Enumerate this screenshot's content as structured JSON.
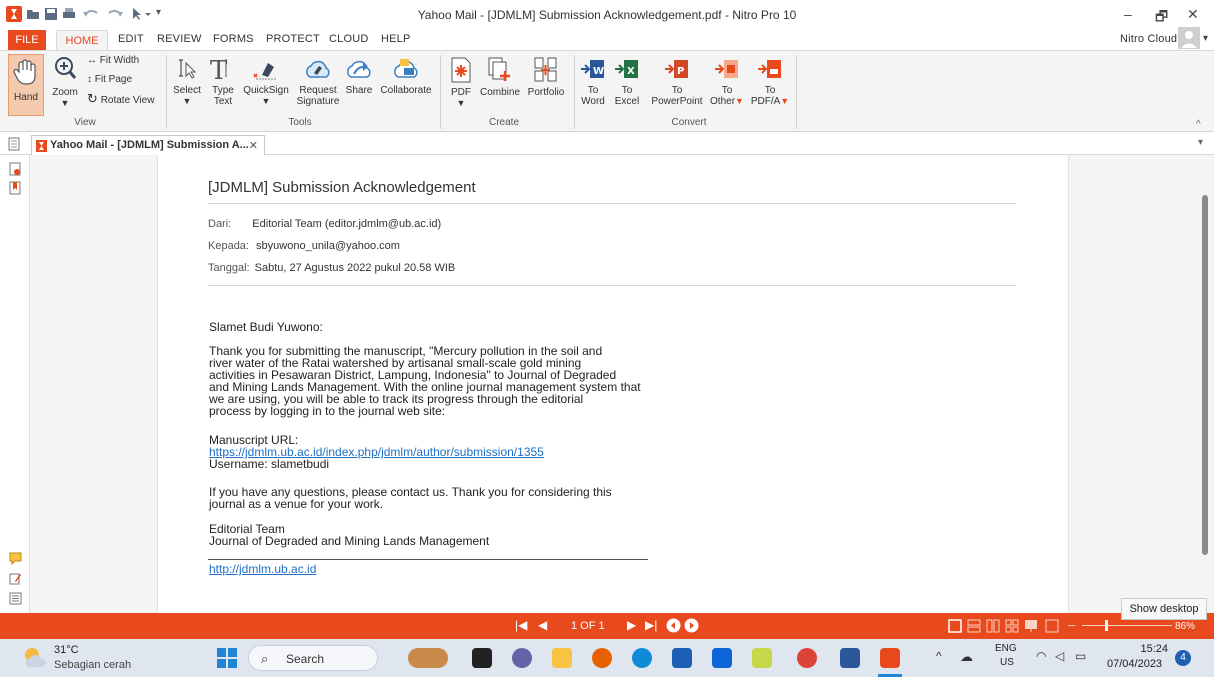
{
  "window": {
    "title": "Yahoo Mail - [JDMLM] Submission Acknowledgement.pdf - Nitro Pro 10",
    "minimize": "–",
    "restore": "🗗",
    "close": "✕"
  },
  "menu": {
    "file": "FILE",
    "home": "HOME",
    "edit": "EDIT",
    "review": "REVIEW",
    "forms": "FORMS",
    "protect": "PROTECT",
    "cloud": "CLOUD",
    "help": "HELP",
    "account": "Nitro Cloud"
  },
  "ribbon": {
    "view": {
      "label": "View",
      "hand": "Hand",
      "zoom": "Zoom",
      "fit_width": "Fit Width",
      "fit_page": "Fit Page",
      "rotate_view": "Rotate View"
    },
    "tools": {
      "label": "Tools",
      "select": "Select",
      "type_text_1": "Type",
      "type_text_2": "Text",
      "quicksign": "QuickSign",
      "request_signature_1": "Request",
      "request_signature_2": "Signature",
      "share": "Share",
      "collaborate": "Collaborate"
    },
    "create": {
      "label": "Create",
      "pdf": "PDF",
      "combine": "Combine",
      "portfolio": "Portfolio"
    },
    "convert": {
      "label": "Convert",
      "to": "To",
      "word": "Word",
      "excel": "Excel",
      "powerpoint": "PowerPoint",
      "other": "Other",
      "pdfa": "PDF/A"
    }
  },
  "doc_tab": {
    "title": "Yahoo Mail - [JDMLM] Submission A...",
    "close": "✕"
  },
  "email": {
    "subject": "[JDMLM] Submission Acknowledgement",
    "from_label": "Dari:",
    "from_value": "Editorial Team (editor.jdmlm@ub.ac.id)",
    "to_label": "Kepada:",
    "to_value": "sbyuwono_unila@yahoo.com",
    "date_label": "Tanggal:",
    "date_value": "Sabtu, 27 Agustus 2022 pukul 20.58 WIB",
    "greeting": "Slamet Budi Yuwono:",
    "para1": [
      "Thank you for submitting the manuscript, \"Mercury pollution in the soil and",
      "river water of the Ratai watershed by artisanal small-scale gold mining",
      "activities in Pesawaran District, Lampung, Indonesia\" to Journal of Degraded",
      "and Mining Lands Management. With the online journal management system that",
      "we are using, you will be able to track its progress through the editorial",
      "process by logging in to the journal web site:"
    ],
    "url_label": "Manuscript URL:",
    "url": "https://jdmlm.ub.ac.id/index.php/jdmlm/author/submission/1355",
    "username": "Username: slametbudi",
    "para2": [
      "If you have any questions, please contact us. Thank you for considering this",
      "journal as a venue for your work."
    ],
    "signoff_1": "Editorial Team",
    "signoff_2": "Journal of Degraded and Mining Lands Management",
    "site": "http://jdmlm.ub.ac.id"
  },
  "status": {
    "page": "1 OF 1",
    "zoom": "86%"
  },
  "tooltip": "Show desktop",
  "taskbar": {
    "weather_temp": "31°C",
    "weather_desc": "Sebagian cerah",
    "search": "Search",
    "lang_1": "ENG",
    "lang_2": "US",
    "time": "15:24",
    "date": "07/04/2023",
    "notifications": "4"
  },
  "colors": {
    "accent": "#e8491d",
    "link": "#1f6fc5"
  }
}
